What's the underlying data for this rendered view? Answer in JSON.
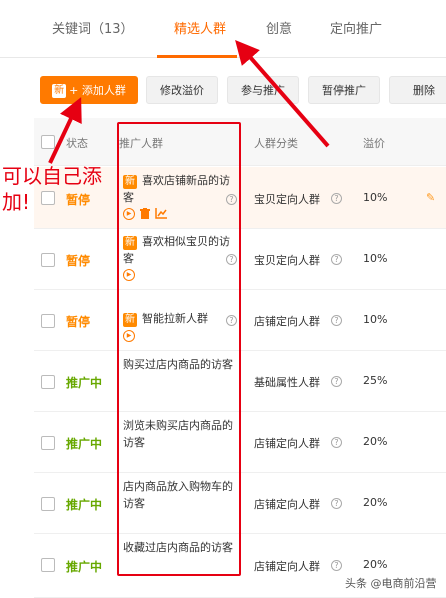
{
  "tabs": [
    {
      "label": "关键词（13）"
    },
    {
      "label": "精选人群"
    },
    {
      "label": "创意"
    },
    {
      "label": "定向推广"
    }
  ],
  "toolbar": {
    "add_tag": "新",
    "add_label": "+ 添加人群",
    "modify_bid": "修改溢价",
    "join_promo": "参与推广",
    "pause_promo": "暂停推广",
    "delete": "删除"
  },
  "table": {
    "headers": {
      "status": "状态",
      "crowd": "推广人群",
      "category": "人群分类",
      "bid": "溢价"
    },
    "new_tag": "新",
    "rows": [
      {
        "status": "暂停",
        "name": "喜欢店铺新品的访客",
        "category": "宝贝定向人群",
        "bid": "10%"
      },
      {
        "status": "暂停",
        "name": "喜欢相似宝贝的访客",
        "category": "宝贝定向人群",
        "bid": "10%"
      },
      {
        "status": "暂停",
        "name": "智能拉新人群",
        "category": "店铺定向人群",
        "bid": "10%"
      },
      {
        "status": "推广中",
        "name": "购买过店内商品的访客",
        "category": "基础属性人群",
        "bid": "25%"
      },
      {
        "status": "推广中",
        "name": "浏览未购买店内商品的访客",
        "category": "店铺定向人群",
        "bid": "20%"
      },
      {
        "status": "推广中",
        "name": "店内商品放入购物车的访客",
        "category": "店铺定向人群",
        "bid": "20%"
      },
      {
        "status": "推广中",
        "name": "收藏过店内商品的访客",
        "category": "店铺定向人群",
        "bid": "20%"
      }
    ]
  },
  "annotation": {
    "text": "可以自己添加!"
  },
  "watermark": "头条 @电商前沿营",
  "colors": {
    "accent": "#ff7a00",
    "paused": "#ff8a00",
    "running": "#67a800",
    "annotation": "#e60012"
  }
}
